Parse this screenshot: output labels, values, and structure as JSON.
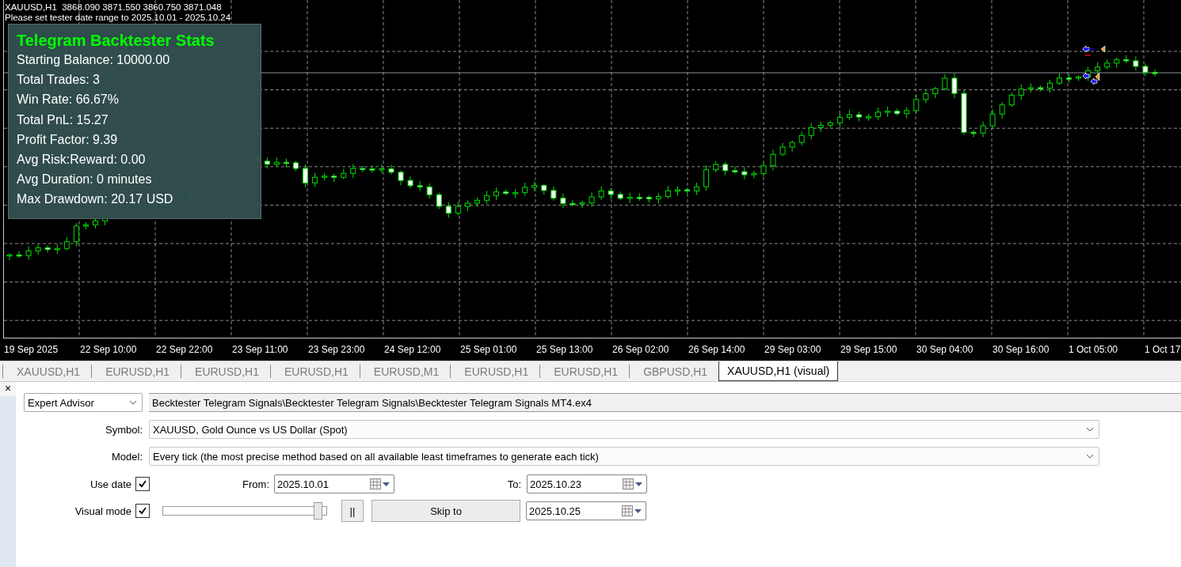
{
  "chart": {
    "header": {
      "symbol_line": "XAUUSD,H1  3868.090 3871.550 3860.750 3871.048",
      "notice": "Please set tester date range to 2025.10.01 - 2025.10.24"
    },
    "stats_panel": {
      "title": "Telegram Backtester Stats",
      "lines": [
        "Starting Balance: 10000.00",
        "Total Trades: 3",
        "Win Rate: 66.67%",
        "Total PnL: 15.27",
        "Profit Factor: 9.39",
        "Avg Risk:Reward: 0.00",
        "Avg Duration: 0 minutes",
        "Max Drawdown: 20.17 USD"
      ]
    },
    "time_axis": [
      "19 Sep 2025",
      "22 Sep 10:00",
      "22 Sep 22:00",
      "23 Sep 11:00",
      "23 Sep 23:00",
      "24 Sep 12:00",
      "25 Sep 01:00",
      "25 Sep 13:00",
      "26 Sep 02:00",
      "26 Sep 14:00",
      "29 Sep 03:00",
      "29 Sep 15:00",
      "30 Sep 04:00",
      "30 Sep 16:00",
      "1 Oct 05:00",
      "1 Oct 17"
    ]
  },
  "tabs": [
    {
      "label": "XAUUSD,H1",
      "selected": false
    },
    {
      "label": "EURUSD,H1",
      "selected": false
    },
    {
      "label": "EURUSD,H1",
      "selected": false
    },
    {
      "label": "EURUSD,H1",
      "selected": false
    },
    {
      "label": "EURUSD,M1",
      "selected": false
    },
    {
      "label": "EURUSD,H1",
      "selected": false
    },
    {
      "label": "EURUSD,H1",
      "selected": false
    },
    {
      "label": "GBPUSD,H1",
      "selected": false
    },
    {
      "label": "XAUUSD,H1 (visual)",
      "selected": true
    }
  ],
  "tester": {
    "close": "×",
    "program_type": "Expert Advisor",
    "program_path": "Becktester Telegram Signals\\Becktester Telegram Signals\\Becktester Telegram Signals MT4.ex4",
    "symbol": {
      "label": "Symbol:",
      "value": "XAUUSD, Gold Ounce vs US Dollar (Spot)"
    },
    "model": {
      "label": "Model:",
      "value": "Every tick (the most precise method based on all available least timeframes to generate each tick)"
    },
    "use_date": {
      "label": "Use date",
      "checked": true
    },
    "from": {
      "label": "From:",
      "value": "2025.10.01"
    },
    "to": {
      "label": "To:",
      "value": "2025.10.23"
    },
    "visual_mode": {
      "label": "Visual mode",
      "checked": true
    },
    "speed_slider": {
      "level": 0.97
    },
    "pause_button": "||",
    "skip_button": "Skip to",
    "skip_date": "2025.10.25"
  }
}
